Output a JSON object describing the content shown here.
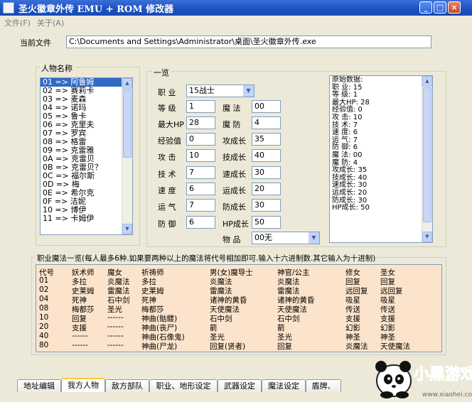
{
  "window": {
    "title": "圣火徽章外传 EMU + ROM 修改器",
    "minimize": "_",
    "maximize": "□",
    "close": "×"
  },
  "menu": [
    "文件(F)",
    "关于(A)"
  ],
  "current_file": {
    "label": "当前文件",
    "value": "C:\\Documents and Settings\\Administrator\\桌面\\圣火徽章外传.exe"
  },
  "characters": {
    "legend": "人物名称",
    "items": [
      "01 => 阿鲁姆",
      "02 => 赛莉卡",
      "03 => 麦森",
      "04 => 诺玛",
      "05 => 鲁卡",
      "06 => 克里夫",
      "07 => 罗宾",
      "08 => 格雷",
      "09 => 克雷雅",
      "0A => 克雷贝",
      "0B => 克雷贝？",
      "0C => 福尔斯",
      "0D => 梅",
      "0E => 希尔克",
      "0F => 洁妮",
      "10 => 博伊",
      "11 => 卡姆伊"
    ],
    "selected_index": 0
  },
  "overview": {
    "legend": "一览",
    "class_label": "职 业",
    "class_value": "15战士",
    "stats_left": [
      {
        "label": "等 级",
        "value": "1"
      },
      {
        "label": "最大HP",
        "value": "28"
      },
      {
        "label": "经验值",
        "value": "0"
      },
      {
        "label": "攻 击",
        "value": "10"
      },
      {
        "label": "技 术",
        "value": "7"
      },
      {
        "label": "速 度",
        "value": "6"
      },
      {
        "label": "运 气",
        "value": "7"
      },
      {
        "label": "防 御",
        "value": "6"
      }
    ],
    "stats_right": [
      {
        "label": "魔 法",
        "value": "00"
      },
      {
        "label": "魔 防",
        "value": "4"
      },
      {
        "label": "攻成长",
        "value": "35"
      },
      {
        "label": "技成长",
        "value": "40"
      },
      {
        "label": "速成长",
        "value": "30"
      },
      {
        "label": "运成长",
        "value": "20"
      },
      {
        "label": "防成长",
        "value": "30"
      },
      {
        "label": "HP成长",
        "value": "50"
      }
    ],
    "item_label": "物 品",
    "item_value": "00无"
  },
  "raw_data": [
    "原始数据:",
    "职 业: 15",
    "等 级: 1",
    "最大HP: 28",
    "经验值: 0",
    "攻 击: 10",
    "技 术: 7",
    "速 度: 6",
    "运 气: 7",
    "防 御: 6",
    "魔 法: 00",
    "魔 防: 4",
    "攻成长: 35",
    "技成长: 40",
    "速成长: 30",
    "运成长: 20",
    "防成长: 30",
    "HP成长: 50"
  ],
  "magic": {
    "legend": "职业魔法一览(每人最多6种.如果要两种以上的魔法将代号相加即可.输入十六进制数.其它输入为十进制)",
    "rows": [
      [
        "代号",
        "妖术师",
        "魔女",
        "祈祷师",
        "男(女)魔导士",
        "神官/公主",
        "修女",
        "圣女"
      ],
      [
        "01",
        "多拉",
        "炎魔法",
        "多拉",
        "炎魔法",
        "炎魔法",
        "回复",
        "回复"
      ],
      [
        "02",
        "史莱姆",
        "雷魔法",
        "史莱姆",
        "雷魔法",
        "雷魔法",
        "远回复",
        "远回复"
      ],
      [
        "04",
        "死神",
        "石中剑",
        "死神",
        "诸神的黄昏",
        "诸神的黄昏",
        "吸星",
        "吸星"
      ],
      [
        "08",
        "梅都莎",
        "圣光",
        "梅都莎",
        "天使魔法",
        "天使魔法",
        "传送",
        "传送"
      ],
      [
        "10",
        "回复",
        "------",
        "神曲(骷髅)",
        "石中剑",
        "石中剑",
        "支援",
        "支援"
      ],
      [
        "20",
        "支援",
        "------",
        "神曲(丧尸)",
        "箭",
        "箭",
        "幻影",
        "幻影"
      ],
      [
        "40",
        "------",
        "------",
        "神曲(石像鬼)",
        "圣光",
        "圣光",
        "神圣",
        "神圣"
      ],
      [
        "80",
        "------",
        "------",
        "神曲(尸龙)",
        "回复(贤者)",
        "回复",
        "炎魔法",
        "天使魔法"
      ]
    ]
  },
  "tabs": [
    "地址编辑",
    "我方人物",
    "敌方部队",
    "职业、地形设定",
    "武器设定",
    "魔法设定",
    "盾牌、"
  ],
  "active_tab": 1,
  "watermark": {
    "text": "小黑游戏",
    "url": "www.xiaohei.com"
  },
  "colors": {
    "titlebar": "#1c4fc0",
    "selection": "#316ac5",
    "magic_bg": "#fce4cc"
  }
}
